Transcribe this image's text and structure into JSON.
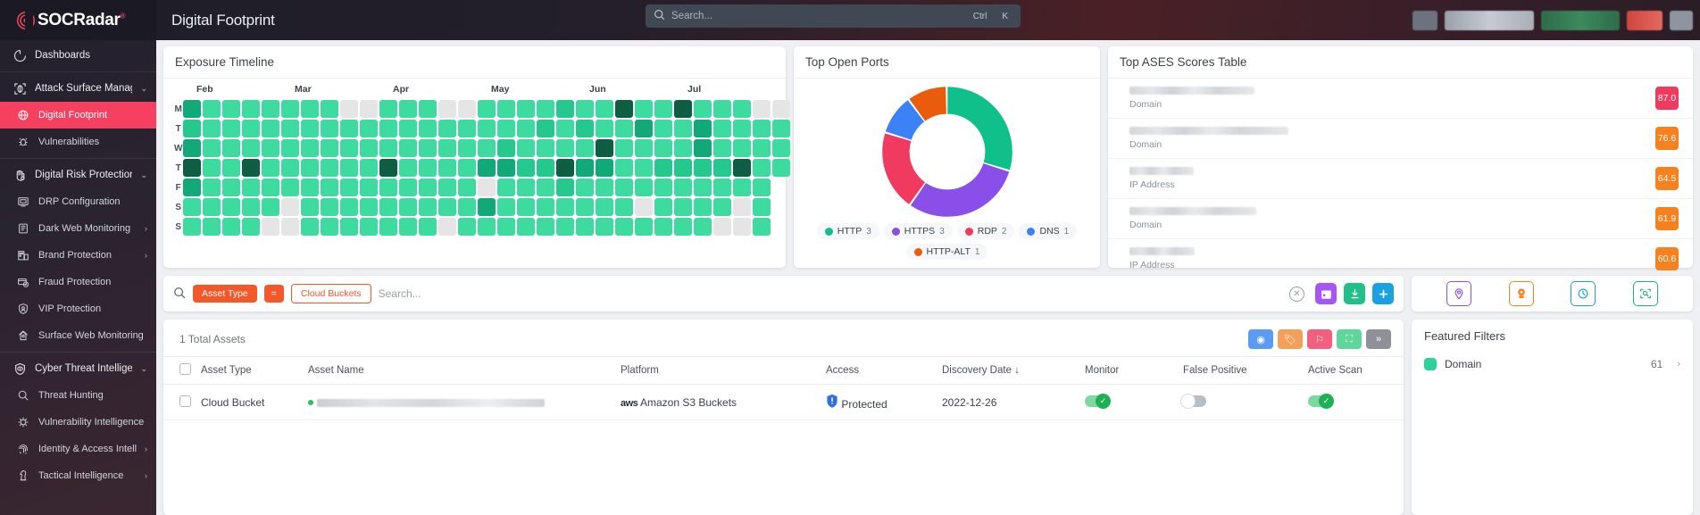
{
  "brand": {
    "name": "SOCRadar",
    "reg": "®"
  },
  "header": {
    "page_title": "Digital Footprint",
    "search": {
      "placeholder": "Search...",
      "value": "",
      "kbd_ctrl": "Ctrl",
      "kbd_key": "K",
      "icon": "search-icon"
    }
  },
  "sidebar": {
    "items": [
      {
        "label": "Dashboards",
        "icon": "dashboard-icon",
        "type": "group",
        "active": false,
        "chevron": ""
      },
      {
        "label": "Attack Surface Management",
        "icon": "asm-icon",
        "type": "group",
        "active": false,
        "chevron": "⌄"
      },
      {
        "label": "Digital Footprint",
        "icon": "globe-icon",
        "type": "sub",
        "active": true,
        "chevron": ""
      },
      {
        "label": "Vulnerabilities",
        "icon": "bug-icon",
        "type": "sub",
        "active": false,
        "chevron": ""
      },
      {
        "label": "Digital Risk Protection",
        "icon": "hand-icon",
        "type": "group",
        "active": false,
        "chevron": "⌄"
      },
      {
        "label": "DRP Configuration",
        "icon": "monitor-icon",
        "type": "sub",
        "active": false,
        "chevron": ""
      },
      {
        "label": "Dark Web Monitoring",
        "icon": "darkweb-icon",
        "type": "sub",
        "active": false,
        "chevron": "›"
      },
      {
        "label": "Brand Protection",
        "icon": "brand-icon",
        "type": "sub",
        "active": false,
        "chevron": "›"
      },
      {
        "label": "Fraud Protection",
        "icon": "fraud-icon",
        "type": "sub",
        "active": false,
        "chevron": ""
      },
      {
        "label": "VIP Protection",
        "icon": "vip-icon",
        "type": "sub",
        "active": false,
        "chevron": ""
      },
      {
        "label": "Surface Web Monitoring",
        "icon": "surfaceweb-icon",
        "type": "sub",
        "active": false,
        "chevron": ""
      },
      {
        "label": "Cyber Threat Intelligence",
        "icon": "cti-icon",
        "type": "group",
        "active": false,
        "chevron": "⌄"
      },
      {
        "label": "Threat Hunting",
        "icon": "search-icon",
        "type": "sub",
        "active": false,
        "chevron": ""
      },
      {
        "label": "Vulnerability Intelligence",
        "icon": "vulnintel-icon",
        "type": "sub",
        "active": false,
        "chevron": ""
      },
      {
        "label": "Identity & Access Intelligence",
        "icon": "fingerprint-icon",
        "type": "sub",
        "active": false,
        "chevron": "›"
      },
      {
        "label": "Tactical Intelligence",
        "icon": "chess-icon",
        "type": "sub",
        "active": false,
        "chevron": "›"
      }
    ]
  },
  "exposure_timeline": {
    "title": "Exposure Timeline",
    "day_labels": [
      "M",
      "T",
      "W",
      "T",
      "F",
      "S",
      "S"
    ],
    "months": [
      {
        "label": "Feb",
        "col": 0
      },
      {
        "label": "Mar",
        "col": 5
      },
      {
        "label": "Apr",
        "col": 10
      },
      {
        "label": "May",
        "col": 15
      },
      {
        "label": "Jun",
        "col": 20
      },
      {
        "label": "Jul",
        "col": 25
      }
    ]
  },
  "chart_data": [
    {
      "type": "heatmap",
      "title": "Exposure Timeline",
      "xlabel": "",
      "ylabel": "",
      "grid": false,
      "legend_position": "none",
      "row_labels": [
        "M",
        "T",
        "W",
        "T",
        "F",
        "S",
        "S"
      ],
      "col_labels": [
        "Feb",
        "",
        "",
        "",
        "",
        "Mar",
        "",
        "",
        "",
        "",
        "Apr",
        "",
        "",
        "",
        "",
        "May",
        "",
        "",
        "",
        "",
        "Jun",
        "",
        "",
        "",
        "",
        "Jul",
        "",
        "",
        ""
      ],
      "color_levels": [
        "#e5e5e5",
        "#3ddba0",
        "#26c98d",
        "#11a978",
        "#0f5e43"
      ],
      "values": [
        [
          3,
          1,
          1,
          1,
          1,
          1,
          1,
          1,
          0,
          0,
          1,
          1,
          1,
          0,
          0,
          1,
          1,
          1,
          1,
          2,
          1,
          1,
          4,
          1,
          1,
          4,
          1,
          1,
          1,
          0,
          0
        ],
        [
          2,
          1,
          1,
          1,
          1,
          1,
          1,
          1,
          1,
          1,
          1,
          1,
          1,
          1,
          1,
          1,
          1,
          1,
          2,
          1,
          2,
          1,
          1,
          3,
          1,
          1,
          3,
          1,
          1,
          1,
          1
        ],
        [
          3,
          1,
          1,
          1,
          1,
          1,
          1,
          1,
          1,
          1,
          1,
          1,
          1,
          1,
          1,
          1,
          2,
          1,
          1,
          1,
          1,
          4,
          1,
          1,
          1,
          1,
          3,
          1,
          1,
          1,
          1
        ],
        [
          4,
          1,
          1,
          4,
          1,
          1,
          1,
          1,
          1,
          1,
          4,
          1,
          1,
          1,
          1,
          3,
          3,
          2,
          2,
          4,
          3,
          3,
          1,
          1,
          2,
          2,
          2,
          2,
          4,
          1,
          1
        ],
        [
          3,
          1,
          1,
          1,
          1,
          1,
          1,
          1,
          1,
          1,
          1,
          1,
          1,
          1,
          1,
          0,
          1,
          1,
          1,
          2,
          1,
          1,
          1,
          1,
          1,
          1,
          1,
          1,
          1,
          1,
          -1
        ],
        [
          1,
          1,
          1,
          1,
          1,
          0,
          1,
          1,
          1,
          1,
          1,
          1,
          1,
          1,
          1,
          3,
          1,
          1,
          1,
          1,
          1,
          1,
          1,
          0,
          1,
          1,
          1,
          1,
          0,
          1,
          -1
        ],
        [
          1,
          1,
          1,
          1,
          0,
          0,
          1,
          1,
          1,
          1,
          1,
          1,
          1,
          0,
          1,
          1,
          1,
          1,
          1,
          1,
          1,
          1,
          1,
          1,
          1,
          1,
          1,
          0,
          0,
          1,
          -1
        ]
      ]
    },
    {
      "type": "pie",
      "title": "Top Open Ports",
      "legend_position": "bottom",
      "categories": [
        "HTTP",
        "HTTPS",
        "RDP",
        "DNS",
        "HTTP-ALT"
      ],
      "values": [
        3,
        3,
        2,
        1,
        1
      ],
      "colors": [
        "#0fc08a",
        "#8a4fe8",
        "#f03a5f",
        "#3b82f6",
        "#ea5b0c"
      ]
    }
  ],
  "top_open_ports": {
    "title": "Top Open Ports",
    "legend": [
      {
        "label": "HTTP",
        "count": "3",
        "color": "#0fc08a"
      },
      {
        "label": "HTTPS",
        "count": "3",
        "color": "#8a4fe8"
      },
      {
        "label": "RDP",
        "count": "2",
        "color": "#f03a5f"
      },
      {
        "label": "DNS",
        "count": "1",
        "color": "#3b82f6"
      },
      {
        "label": "HTTP-ALT",
        "count": "1",
        "color": "#ea5b0c"
      }
    ]
  },
  "top_ases": {
    "title": "Top ASES Scores Table",
    "rows": [
      {
        "name_redacted": true,
        "name_width": 140,
        "type": "Domain",
        "score": "87.0",
        "color": "#f03a5f"
      },
      {
        "name_redacted": true,
        "name_width": 178,
        "type": "Domain",
        "score": "76.6",
        "color": "#f5821f"
      },
      {
        "name_redacted": true,
        "name_width": 72,
        "type": "IP Address",
        "score": "64.5",
        "color": "#f5821f"
      },
      {
        "name_redacted": true,
        "name_width": 142,
        "type": "Domain",
        "score": "61.9",
        "color": "#f5821f"
      },
      {
        "name_redacted": true,
        "name_width": 73,
        "type": "IP Address",
        "score": "60.6",
        "color": "#f5821f"
      }
    ]
  },
  "filter_bar": {
    "search_icon": "search-icon",
    "field_chip": "Asset Type",
    "operator_chip": "=",
    "value_chip": "Cloud Buckets",
    "search_placeholder": "Search...",
    "search_value": "",
    "clear_icon": "clear-circle-icon",
    "buttons": [
      {
        "name": "calendar-button",
        "icon": "calendar-icon",
        "color": "#a855f7",
        "glyph": "▤"
      },
      {
        "name": "download-button",
        "icon": "download-icon",
        "color": "#21c08a",
        "glyph": "⬇"
      },
      {
        "name": "add-button",
        "icon": "plus-icon",
        "color": "#1ba0e2",
        "glyph": "+"
      }
    ]
  },
  "tool_card": {
    "buttons": [
      {
        "name": "location-pin-button",
        "icon": "map-pin-icon",
        "color": "#8a4fe8"
      },
      {
        "name": "brand-pin-button",
        "icon": "brand-pin-icon",
        "color": "#f5821f"
      },
      {
        "name": "history-button",
        "icon": "clock-icon",
        "color": "#1ba0e2"
      },
      {
        "name": "scan-button",
        "icon": "scan-icon",
        "color": "#22b573"
      }
    ]
  },
  "assets_table": {
    "count_label": "1 Total Assets",
    "row_actions": [
      {
        "name": "view-button",
        "icon": "eye-icon",
        "color": "#5b9bf3",
        "glyph": "◉"
      },
      {
        "name": "tag-button",
        "icon": "tag-icon",
        "color": "#f5a05a",
        "glyph": "🏷"
      },
      {
        "name": "dislike-button",
        "icon": "thumbs-down-icon",
        "color": "#f2607f",
        "glyph": "⚐"
      },
      {
        "name": "scan-button",
        "icon": "scan-icon",
        "color": "#5fd69a",
        "glyph": "⛶"
      },
      {
        "name": "more-button",
        "icon": "chevron-double-right-icon",
        "color": "#8e9298",
        "glyph": "»"
      }
    ],
    "columns": [
      "Asset Type",
      "Asset Name",
      "Platform",
      "Access",
      "Discovery Date",
      "Monitor",
      "False Positive",
      "Active Scan"
    ],
    "sorted_column": "Discovery Date",
    "sort_arrow": "↓",
    "rows": [
      {
        "asset_type": "Cloud Bucket",
        "asset_name_redacted": true,
        "platform_brand": "aws",
        "platform": "Amazon S3 Buckets",
        "access": "Protected",
        "access_icon": "shield-icon",
        "discovery_date": "2022-12-26",
        "monitor": true,
        "false_positive": false,
        "active_scan": true
      }
    ]
  },
  "featured_filters": {
    "title": "Featured Filters",
    "items": [
      {
        "label": "Domain",
        "count": "61",
        "color": "#2fd19b",
        "chevron": "›"
      }
    ]
  }
}
